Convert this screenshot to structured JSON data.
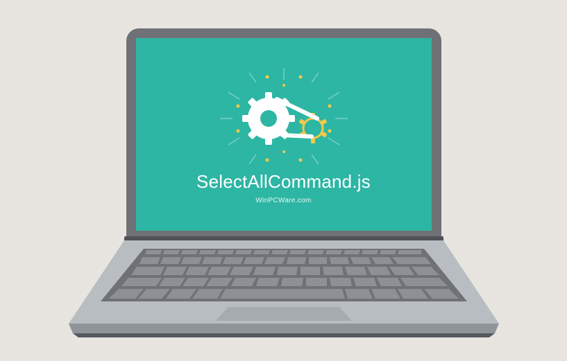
{
  "filename": "SelectAllCommand.js",
  "site": "WinPCWare.com",
  "colors": {
    "background": "#e8e4df",
    "chassis": "#6f7176",
    "screen": "#2db6a3",
    "accent_yellow": "#f2c94c",
    "accent_white": "#ffffff"
  },
  "icon": "gears-with-belt-icon"
}
